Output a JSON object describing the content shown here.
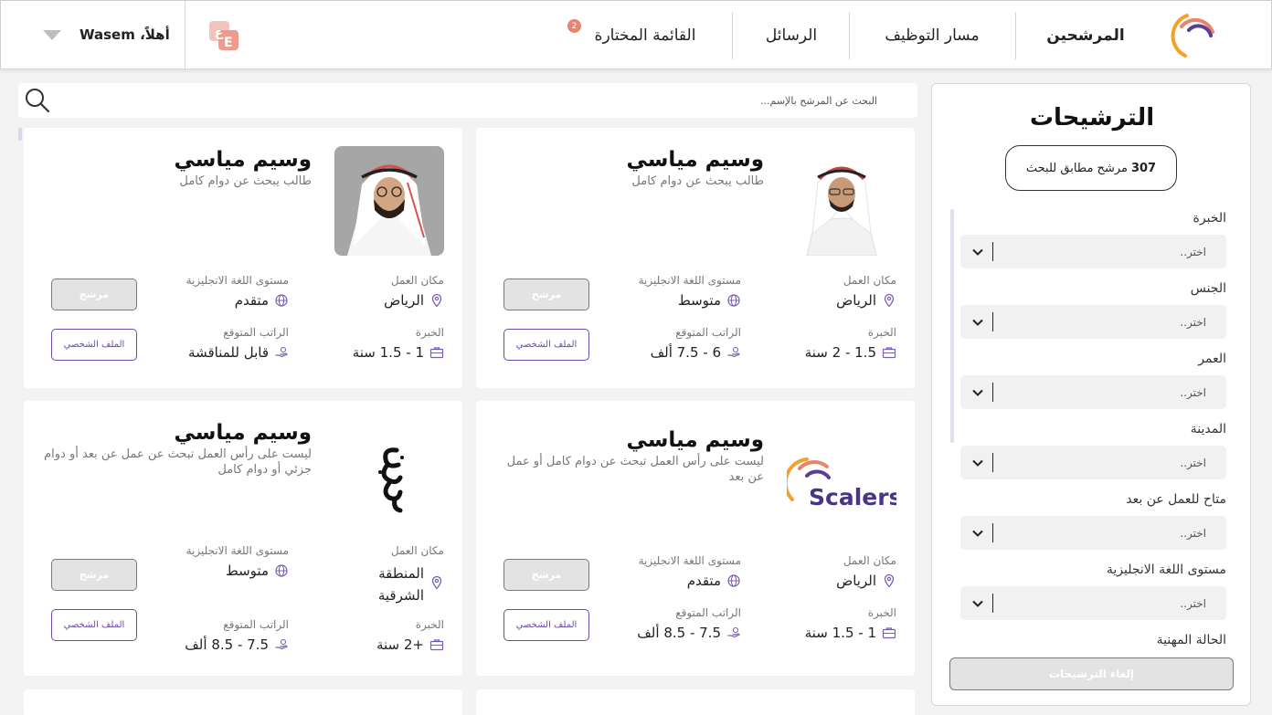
{
  "header": {
    "nav": [
      {
        "label": "المرشحين",
        "active": true
      },
      {
        "label": "مسار التوظيف"
      },
      {
        "label": "الرسائل"
      },
      {
        "label": "القائمة المختارة",
        "badge": "2"
      }
    ],
    "greeting": "أهلاً، Wasem"
  },
  "search": {
    "placeholder": "البحث عن المرشح بالإسم..."
  },
  "labels": {
    "location": "مكان العمل",
    "english": "مستوى اللغة الانجليزية",
    "experience": "الخبرة",
    "salary": "الراتب المتوقع",
    "candidate_btn": "مرشح",
    "profile_btn": "الملف الشخصي"
  },
  "cards": [
    {
      "name": "وسيم مياسي",
      "desc": "طالب يبحث عن دوام كامل",
      "location": "الرياض",
      "english": "متوسط",
      "experience": "1.5 - 2 سنة",
      "salary": "6 - 7.5 ألف",
      "photo": "man-portrait"
    },
    {
      "name": "وسيم مياسي",
      "desc": "طالب يبحث عن دوام كامل",
      "location": "الرياض",
      "english": "متقدم",
      "experience": "1 - 1.5 سنة",
      "salary": "قابل للمناقشة",
      "photo": "man-portrait-grey"
    },
    {
      "name": "وسيم مياسي",
      "desc": "ليست على رأس العمل تبحث عن دوام كامل أو عمل عن بعد",
      "location": "الرياض",
      "english": "متقدم",
      "experience": "1 - 1.5 سنة",
      "salary": "7.5 - 8.5 ألف",
      "photo": "scalers-logo",
      "logo_text": "Scalers"
    },
    {
      "name": "وسيم مياسي",
      "desc": "ليست على رأس العمل تبحث عن عمل عن بعد أو دوام جزئي أو دوام كامل",
      "location": "المنطقة الشرقية",
      "english": "متوسط",
      "experience": "+2 سنة",
      "salary": "7.5 - 8.5 ألف",
      "photo": "calligraphy-logo"
    }
  ],
  "filters": {
    "title": "الترشيحات",
    "count": "307",
    "count_text": "مرشح مطابق للبحث",
    "placeholder": "اختر..",
    "fields": [
      "الخبرة",
      "الجنس",
      "العمر",
      "المدينة",
      "متاح للعمل عن بعد",
      "مستوى اللغة الانجليزية",
      "الحالة المهنية"
    ],
    "clear_label": "إلغاء الترشيحات"
  },
  "colors": {
    "brand_purple": "#5b3f8f",
    "brand_orange": "#f2a229",
    "accent_pink": "#e8836d"
  }
}
